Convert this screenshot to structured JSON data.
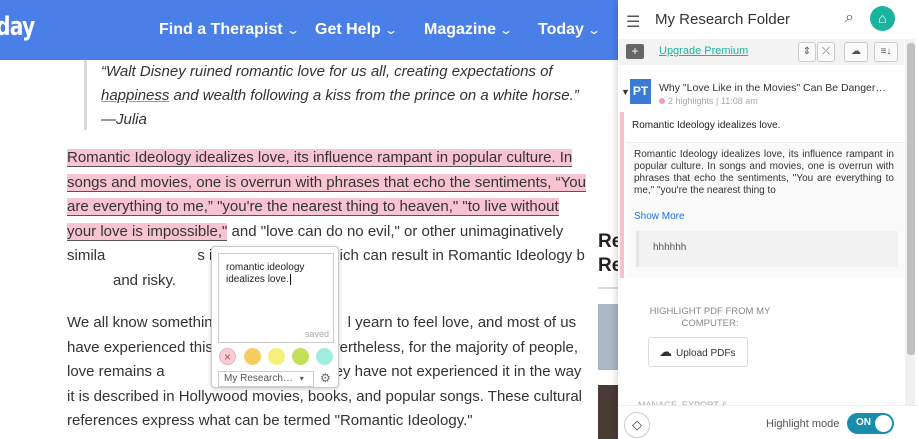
{
  "nav": {
    "logo": "day",
    "items": [
      {
        "label": "Find a Therapist",
        "chevron": "⌄"
      },
      {
        "label": "Get Help",
        "chevron": "⌄"
      },
      {
        "label": "Magazine",
        "chevron": "⌄"
      },
      {
        "label": "Today",
        "chevron": "⌄"
      }
    ]
  },
  "article": {
    "quote_pre": "“Walt Disney ruined romantic love for us all, creating expectations of ",
    "quote_link": "happiness",
    "quote_post": " and wealth following a kiss from the prince on a white horse.” —Julia",
    "p1_highlight": "Romantic Ideology idealizes love, its influence rampant in popular culture. In songs and movies, one is overrun with phrases that echo the sentiments, “You are everything to me,” \"you're the nearest thing to heaven,\" \"to live without your love is impossible,\"",
    "p1_rest_a": " and \"love can do no evil,\" or other unimaginatively simila",
    "p1_rest_b": "s indeed different, which can result in Romantic Ideology b",
    "p1_rest_c": "and risky.",
    "p2_a": "We all know somethin",
    "p2_b": "l yearn to feel love, and most of us have experienced this",
    "p2_c": "Nevertheless, for the majority of people, love remains a",
    "p2_d": "feel that they have not experienced it in the way it is described in Hollywood movies, books, and popular songs. These cultural references express what can be termed \"Romantic Ideology.\""
  },
  "sidebar": {
    "heading": "Re Re"
  },
  "note_popup": {
    "text": "romantic ideology idealizes love.",
    "saved": "saved",
    "remove_glyph": "×",
    "colors": [
      "#f6cd62",
      "#f6f07a",
      "#c4e05a",
      "#9feee0"
    ],
    "folder": "My Research…",
    "folder_arrow": "▾",
    "gear": "⚙"
  },
  "panel": {
    "menu_glyph": "☰",
    "title": "My Research Folder",
    "search_glyph": "⌕",
    "home_glyph": "⌂",
    "upgrade": "Upgrade Premium",
    "add_glyph": "+",
    "toolbar_buttons": [
      "⇕",
      "⤫",
      "☁",
      "≡↓"
    ],
    "doc": {
      "arrow": "▼",
      "logo": "PT",
      "title": "Why \"Love Like in the Movies\" Can Be Danger…",
      "meta": "2 highlights | 11:08 am"
    },
    "highlight": {
      "note": "Romantic Ideology idealizes love.",
      "text": "Romantic Ideology idealizes love, its influence rampant in popular culture. In songs and movies, one is overrun with phrases that echo the sentiments, \"You are everything to me,\" \"you're the nearest thing to",
      "show_more": "Show More",
      "reply": "hhhhhh"
    },
    "pdf": {
      "title": "HIGHLIGHT PDF FROM MY COMPUTER:",
      "upload_glyph": "☁",
      "upload": "Upload PDFs"
    },
    "cut_text": "MANAGE, EXPORT &",
    "bottom": {
      "icon_glyph": "◇",
      "highlight_mode": "Highlight mode",
      "toggle": "ON"
    }
  }
}
